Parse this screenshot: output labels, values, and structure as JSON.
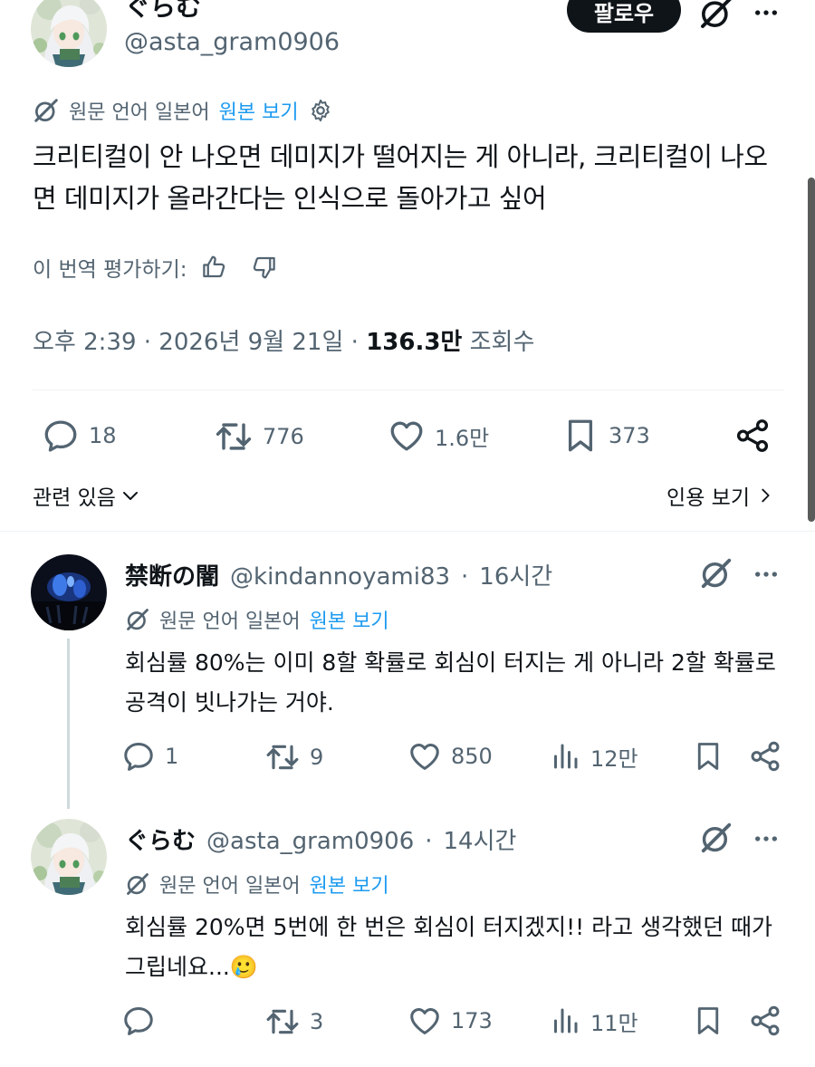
{
  "post": {
    "author_name": "ぐらむ",
    "author_handle": "@asta_gram0906",
    "follow_label": "팔로우",
    "translation": {
      "source_label": "원문 언어 일본어",
      "show_original": "원본 보기"
    },
    "text": "크리티컬이 안 나오면 데미지가 떨어지는 게 아니라, 크리티컬이 나오면 데미지가 올라간다는 인식으로 돌아가고 싶어",
    "rate_label": "이 번역 평가하기:",
    "time": "오후 2:39",
    "date": "2026년 9월 21일",
    "views_count": "136.3만",
    "views_label": "조회수",
    "separator": "·",
    "stats": {
      "replies": "18",
      "reposts": "776",
      "likes": "1.6만",
      "bookmarks": "373"
    },
    "related_label": "관련 있음",
    "quotes_label": "인용 보기"
  },
  "replies": [
    {
      "author_name": "禁断の闇",
      "author_handle": "@kindannoyami83",
      "time": "16시간",
      "translation": {
        "source_label": "원문 언어 일본어",
        "show_original": "원본 보기"
      },
      "text": "회심률 80%는 이미 8할 확률로 회심이 터지는 게 아니라 2할 확률로 공격이 빗나가는 거야.",
      "stats": {
        "replies": "1",
        "reposts": "9",
        "likes": "850",
        "views": "12만"
      }
    },
    {
      "author_name": "ぐらむ",
      "author_handle": "@asta_gram0906",
      "time": "14시간",
      "translation": {
        "source_label": "원문 언어 일본어",
        "show_original": "원본 보기"
      },
      "text": "회심률 20%면 5번에 한 번은 회심이 터지겠지!! 라고 생각했던 때가 그립네요...",
      "emoji": "🥲",
      "stats": {
        "replies": "",
        "reposts": "3",
        "likes": "173",
        "views": "11만"
      }
    }
  ],
  "colors": {
    "text": "#0f1419",
    "muted": "#536471",
    "link": "#1d9bf0",
    "divider": "#eff3f4"
  },
  "icons": [
    "grok-icon",
    "more-icon",
    "gear-icon",
    "thumbs-up-icon",
    "thumbs-down-icon",
    "reply-icon",
    "repost-icon",
    "like-icon",
    "bookmark-icon",
    "share-icon",
    "views-icon",
    "chevron-down-icon",
    "chevron-right-icon"
  ]
}
